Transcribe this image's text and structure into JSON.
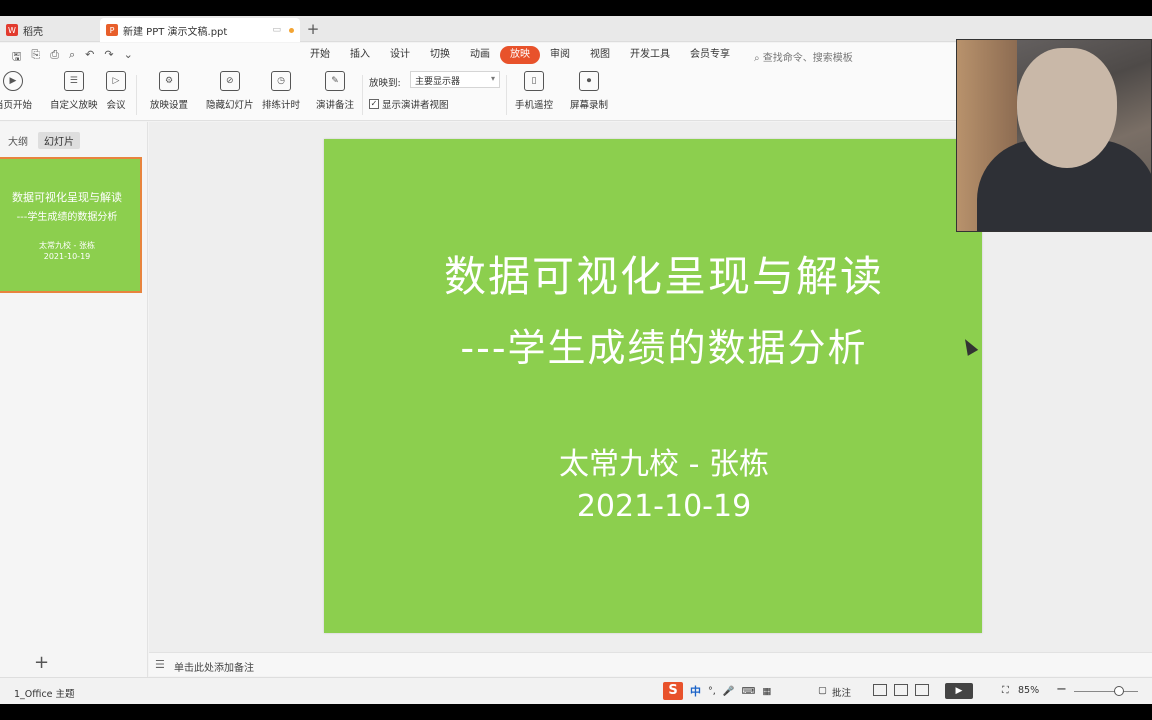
{
  "tabs": {
    "home_label": "稻壳",
    "doc_label": "新建 PPT 演示文稿.ppt",
    "add": "+"
  },
  "menu": {
    "items": [
      "开始",
      "插入",
      "设计",
      "切换",
      "动画",
      "放映",
      "审阅",
      "视图",
      "开发工具",
      "会员专享"
    ],
    "active": "放映",
    "search_placeholder": "查找命令、搜索模板"
  },
  "ribbon": {
    "from_start": "当页开始",
    "custom_show": "自定义放映",
    "meeting": "会议",
    "show_settings": "放映设置",
    "hide_slide": "隐藏幻灯片",
    "rehearse": "排练计时",
    "speaker_notes": "演讲备注",
    "project_to_label": "放映到:",
    "project_to_value": "主要显示器",
    "presenter_view": "显示演讲者视图",
    "phone_remote": "手机遥控",
    "screen_record": "屏幕录制"
  },
  "left_panel": {
    "tab_outline": "大纲",
    "tab_slides": "幻灯片",
    "thumb": {
      "title": "数据可视化呈现与解读",
      "subtitle": "---学生成绩的数据分析",
      "author": "太常九校 - 张栋",
      "date": "2021-10-19"
    },
    "add": "+"
  },
  "slide": {
    "title": "数据可视化呈现与解读",
    "subtitle": "---学生成绩的数据分析",
    "author": "太常九校 - 张栋",
    "date": "2021-10-19",
    "background_color": "#8ccf4e"
  },
  "notes": {
    "placeholder": "单击此处添加备注"
  },
  "status": {
    "theme": "1_Office 主题",
    "ime_logo": "S",
    "ime_mode": "中",
    "annotation": "批注",
    "zoom": "85%"
  },
  "colors": {
    "accent": "#e8522b",
    "slide_green": "#8ccf4e",
    "thumb_border": "#e8843d"
  }
}
